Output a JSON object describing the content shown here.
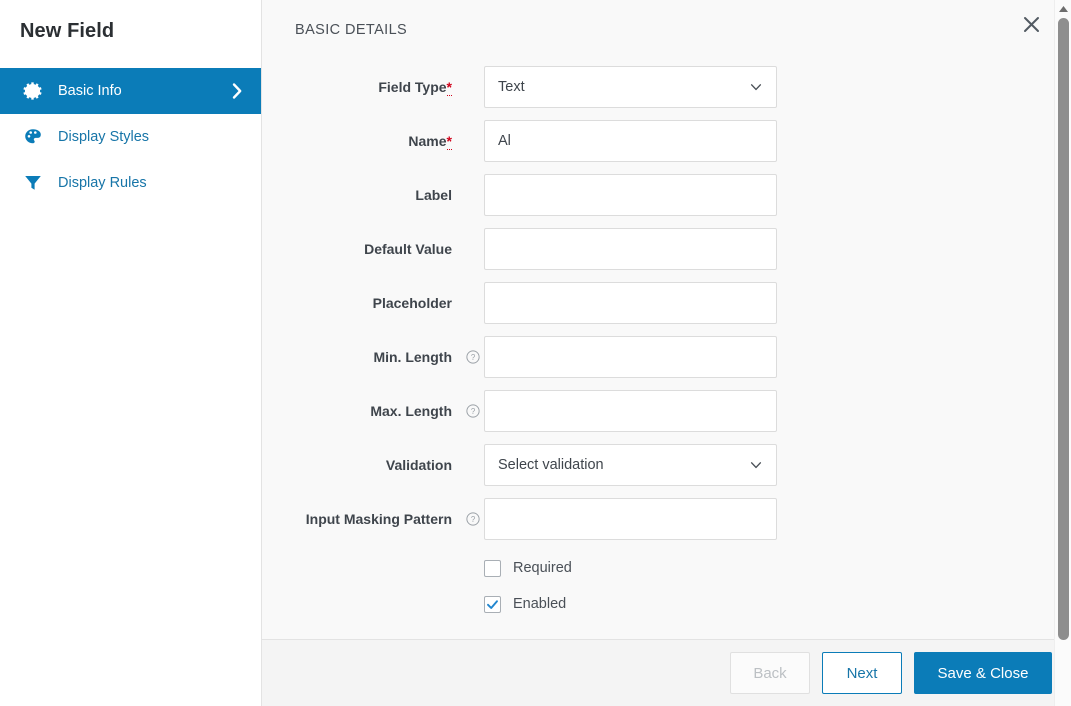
{
  "sidebar": {
    "title": "New Field",
    "items": [
      {
        "label": "Basic Info",
        "icon": "gear-icon",
        "active": true,
        "chevron": true
      },
      {
        "label": "Display Styles",
        "icon": "palette-icon",
        "active": false,
        "chevron": false
      },
      {
        "label": "Display Rules",
        "icon": "funnel-icon",
        "active": false,
        "chevron": false
      }
    ]
  },
  "main": {
    "section_title": "BASIC DETAILS",
    "close_label": "✕"
  },
  "form": {
    "rows": [
      {
        "label": "Field Type",
        "required": true,
        "help": false,
        "type": "select",
        "value": "Text",
        "placeholder": ""
      },
      {
        "label": "Name",
        "required": true,
        "help": false,
        "type": "text",
        "value": "Al",
        "placeholder": ""
      },
      {
        "label": "Label",
        "required": false,
        "help": false,
        "type": "text",
        "value": "",
        "placeholder": ""
      },
      {
        "label": "Default Value",
        "required": false,
        "help": false,
        "type": "text",
        "value": "",
        "placeholder": ""
      },
      {
        "label": "Placeholder",
        "required": false,
        "help": false,
        "type": "text",
        "value": "",
        "placeholder": ""
      },
      {
        "label": "Min. Length",
        "required": false,
        "help": true,
        "type": "text",
        "value": "",
        "placeholder": ""
      },
      {
        "label": "Max. Length",
        "required": false,
        "help": true,
        "type": "text",
        "value": "",
        "placeholder": ""
      },
      {
        "label": "Validation",
        "required": false,
        "help": false,
        "type": "select",
        "value": "Select validation",
        "placeholder": ""
      },
      {
        "label": "Input Masking Pattern",
        "required": false,
        "help": true,
        "type": "text",
        "value": "",
        "placeholder": ""
      }
    ],
    "checkboxes": [
      {
        "label": "Required",
        "checked": false
      },
      {
        "label": "Enabled",
        "checked": true
      }
    ]
  },
  "footer": {
    "back_label": "Back",
    "next_label": "Next",
    "save_label": "Save & Close"
  },
  "colors": {
    "accent": "#0b7cb8",
    "link": "#1775a8",
    "required_star": "#d0021b",
    "content_bg": "#f9f9f9",
    "footer_bg": "#f4f4f4"
  }
}
